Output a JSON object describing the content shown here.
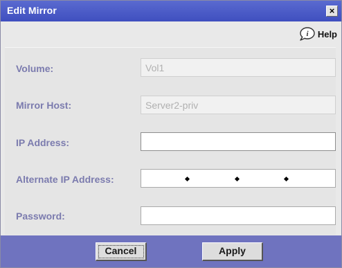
{
  "window": {
    "title": "Edit Mirror",
    "close_label": "×"
  },
  "help": {
    "label": "Help",
    "icon": "help-speech-bubble-icon"
  },
  "fields": [
    {
      "label": "Volume:",
      "value": "Vol1",
      "placeholder": "",
      "disabled": true
    },
    {
      "label": "Mirror Host:",
      "value": "Server2-priv",
      "placeholder": "",
      "disabled": true
    },
    {
      "label": "IP Address:",
      "value": "",
      "placeholder": ""
    },
    {
      "label": "Alternate IP Address:",
      "value": "",
      "placeholder": ""
    },
    {
      "label": "Password:",
      "value": "",
      "placeholder": ""
    }
  ],
  "buttons": {
    "cancel_label": "Cancel",
    "apply_label": "Apply"
  },
  "colors": {
    "titlebar": "#4150c2",
    "label_text": "#7b7bae",
    "button_bar": "#6f73bf",
    "panel": "#e5e5e5"
  }
}
